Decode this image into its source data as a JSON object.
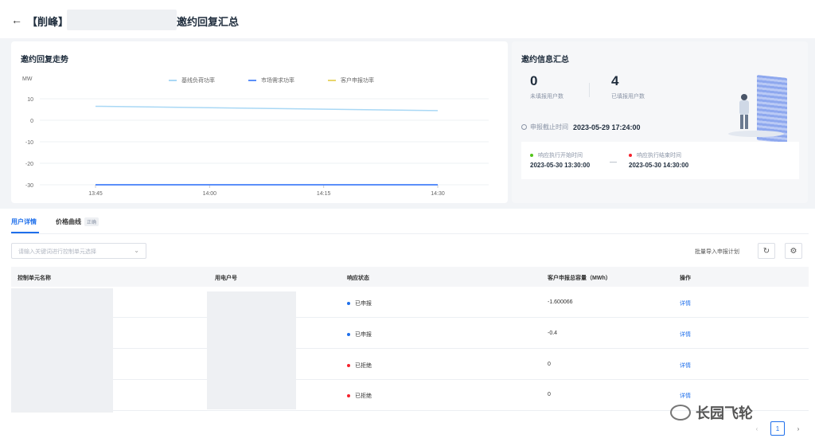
{
  "header": {
    "back_icon": "←",
    "title_prefix": "【削峰】",
    "title_suffix": "邀约回复汇总"
  },
  "chart_card": {
    "title": "邀约回复走势"
  },
  "chart_data": {
    "type": "line",
    "ylabel": "MW",
    "x": [
      "13:45",
      "14:00",
      "14:15",
      "14:30"
    ],
    "ylim": [
      -30,
      10
    ],
    "yticks": [
      10,
      0,
      -10,
      -20,
      -30
    ],
    "grid": true,
    "legend_position": "top",
    "series": [
      {
        "name": "基线负荷功率",
        "color": "#a9d8f5",
        "x": [
          "13:45",
          "14:30"
        ],
        "values": [
          6.5,
          4.5
        ]
      },
      {
        "name": "市场需求功率",
        "color": "#5b8ff9",
        "x": [
          "13:45",
          "14:30"
        ],
        "values": [
          -30,
          -30
        ]
      },
      {
        "name": "客户申报功率",
        "color": "#e8d56b",
        "x": [],
        "values": []
      }
    ]
  },
  "summary": {
    "title": "邀约信息汇总",
    "unreplied_count": "0",
    "unreplied_label": "未填报用户数",
    "replied_count": "4",
    "replied_label": "已填报用户数",
    "deadline_label": "申报截止时间",
    "deadline_value": "2023-05-29 17:24:00",
    "start_label": "响应执行开始时间",
    "start_value": "2023-05-30 13:30:00",
    "end_label": "响应执行结束时间",
    "end_value": "2023-05-30 14:30:00",
    "range_sep": "—",
    "start_color": "#52c41a",
    "end_color": "#f5222d"
  },
  "tabs": {
    "user_detail": "用户详情",
    "price_curve": "价格曲线",
    "price_badge": "正确"
  },
  "toolbar": {
    "search_placeholder": "请输入关键词进行控制单元选择",
    "search_chevron": "⌄",
    "import_label": "批量导入申报计划",
    "refresh_icon": "↻",
    "settings_icon": "⚙"
  },
  "table": {
    "headers": [
      "控制单元名称",
      "用电户号",
      "响应状态",
      "客户申报总容量（MWh）",
      "操作"
    ],
    "rows": [
      {
        "status": "已申报",
        "status_color": "#1f6feb",
        "capacity": "-1.600066",
        "action": "详情"
      },
      {
        "status": "已申报",
        "status_color": "#1f6feb",
        "capacity": "-0.4",
        "action": "详情"
      },
      {
        "status": "已拒绝",
        "status_color": "#f5222d",
        "capacity": "0",
        "action": "详情"
      },
      {
        "status": "已拒绝",
        "status_color": "#f5222d",
        "capacity": "0",
        "action": "详情"
      }
    ]
  },
  "pagination": {
    "prev": "‹",
    "current": "1",
    "next": "›"
  },
  "watermark": {
    "text": "长园飞轮"
  }
}
